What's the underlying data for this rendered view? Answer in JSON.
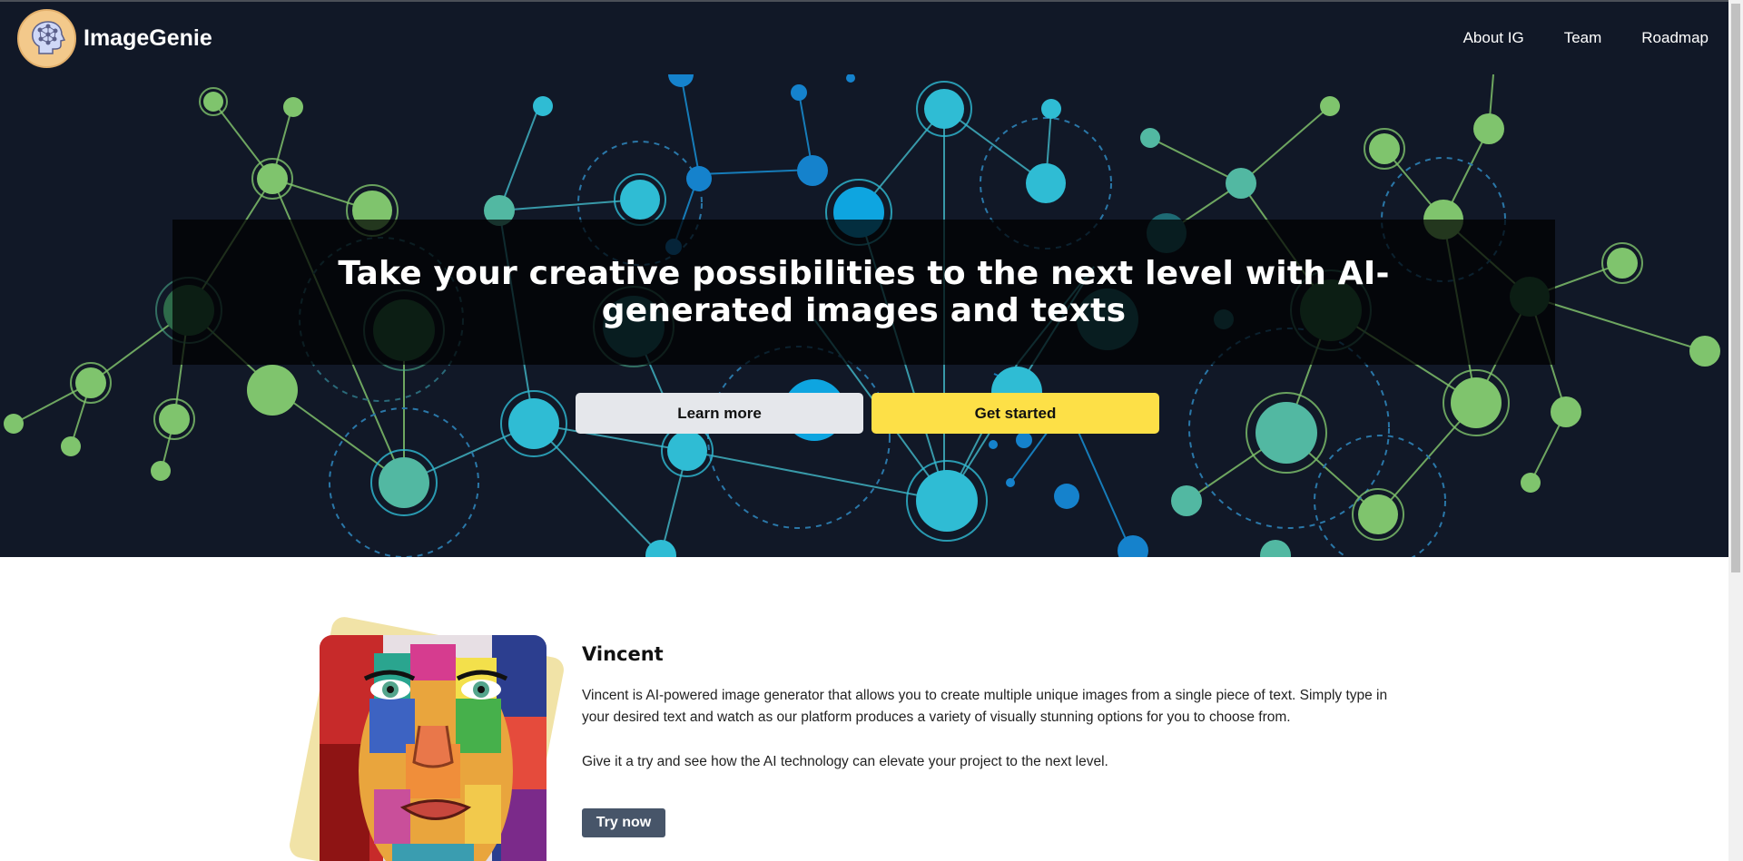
{
  "header": {
    "brand": "ImageGenie",
    "nav": [
      "About IG",
      "Team",
      "Roadmap"
    ]
  },
  "hero": {
    "headline": "Take your creative possibilities to the next level with AI-generated images and texts",
    "learn_more": "Learn more",
    "get_started": "Get started"
  },
  "feature": {
    "title": "Vincent",
    "paragraph1": "Vincent is AI-powered image generator that allows you to create multiple unique images from a single piece of text. Simply type in your desired text and watch as our platform produces a variety of visually stunning options for you to choose from.",
    "paragraph2": "Give it a try and see how the AI technology can elevate your project to the next level.",
    "try_now": "Try now"
  },
  "colors": {
    "header_bg": "#111827",
    "accent_yellow": "#fde047",
    "light_button": "#e5e7eb",
    "try_button": "#475569"
  },
  "icons": {
    "logo": "brain-head-icon"
  }
}
